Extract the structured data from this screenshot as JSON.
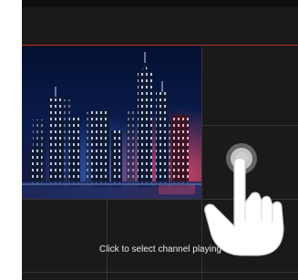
{
  "player": {
    "hint_text": "Click to select channel playing",
    "accent_color": "#b32c2c",
    "background_color": "#1a1a1a"
  },
  "live_channel": {
    "scene": "night city skyline"
  },
  "gesture": {
    "icon": "tap-hand-icon"
  }
}
